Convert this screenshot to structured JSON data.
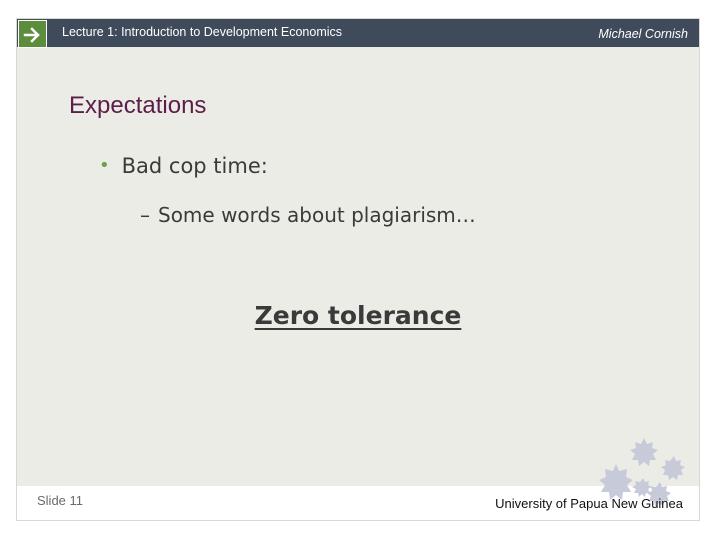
{
  "header": {
    "lecture_title": "Lecture 1:  Introduction to Development Economics",
    "author": "Michael Cornish",
    "arrow_icon": "arrow-right-icon"
  },
  "content": {
    "heading": "Expectations",
    "bullet_1": "Bad cop time:",
    "bullet_1_1": "Some words about plagiarism…",
    "emphasis": "Zero tolerance"
  },
  "footer": {
    "slide_number": "Slide 11",
    "institution": "University of Papua New Guinea",
    "decoration_icon": "gears-icon"
  },
  "colors": {
    "header_bar": "#3f4a5b",
    "accent_green": "#5c8d3c",
    "heading": "#5c1e49",
    "background": "#ecece7"
  }
}
